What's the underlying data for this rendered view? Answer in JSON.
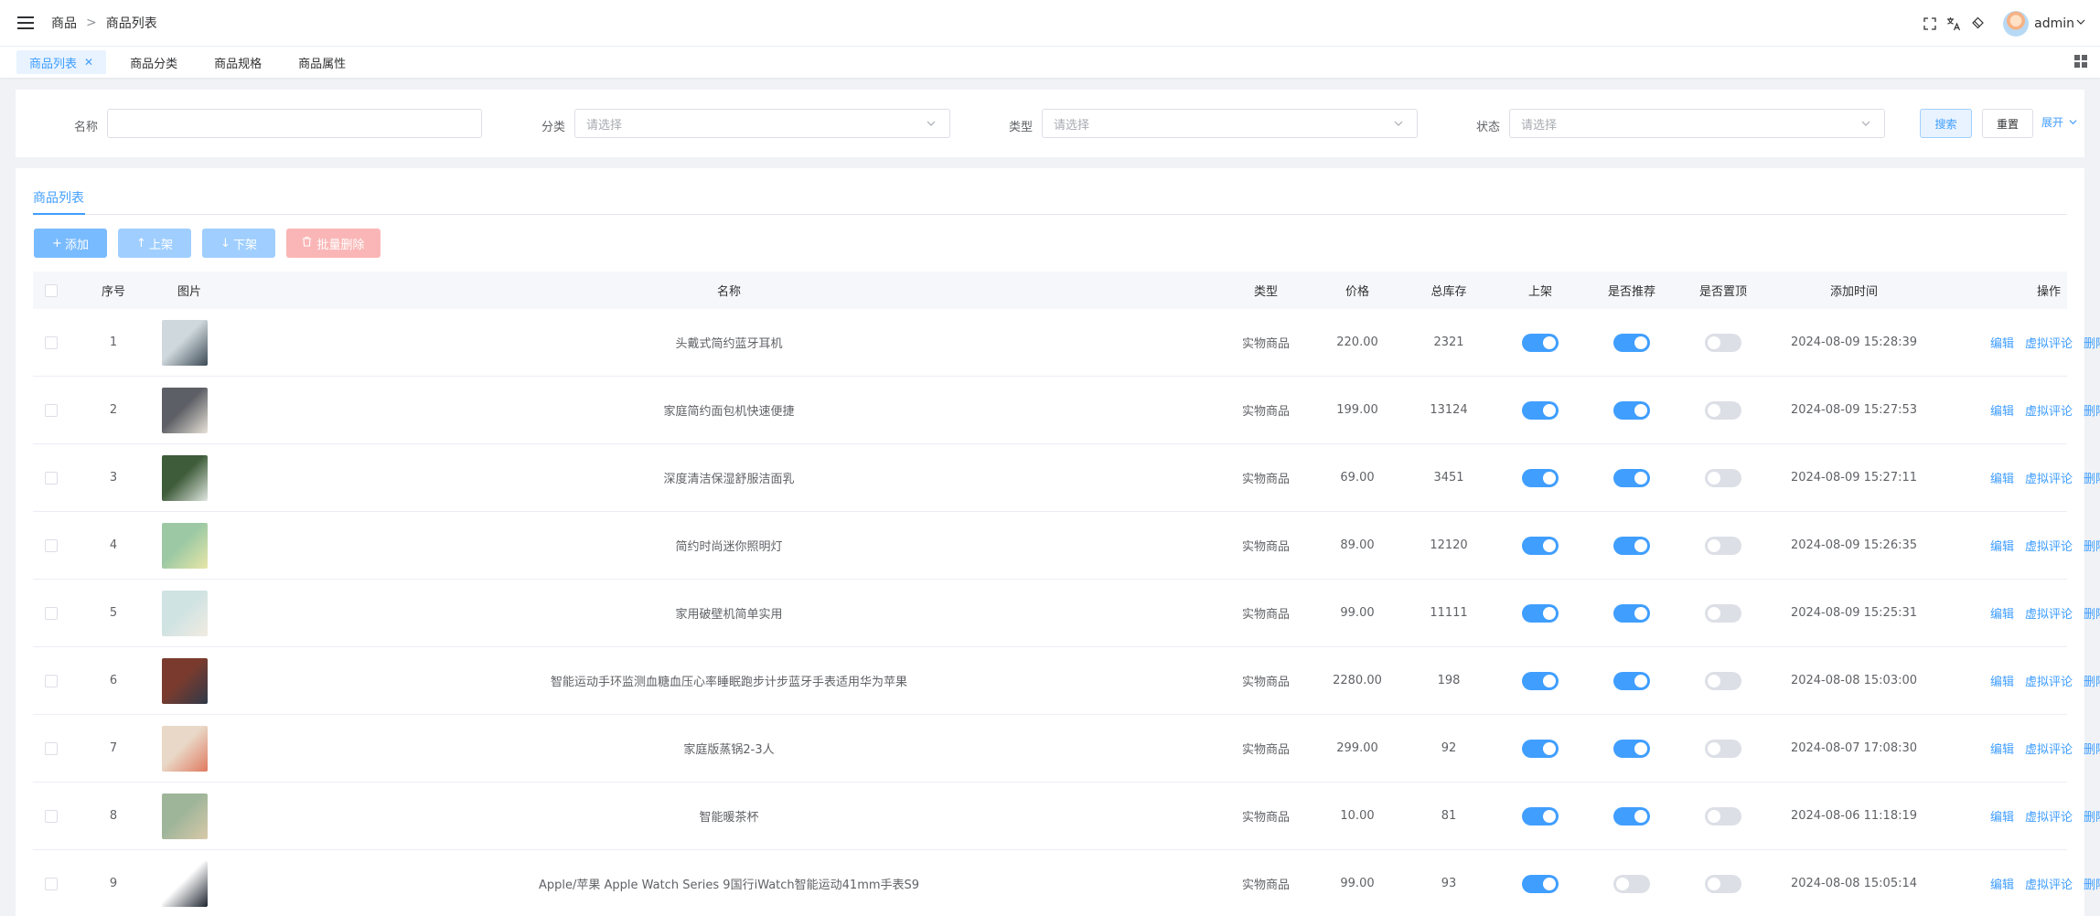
{
  "header": {
    "breadcrumb": [
      "商品",
      "商品列表"
    ],
    "breadcrumb_sep": ">",
    "user": "admin"
  },
  "tabs": [
    {
      "label": "商品列表",
      "active": true
    },
    {
      "label": "商品分类",
      "active": false
    },
    {
      "label": "商品规格",
      "active": false
    },
    {
      "label": "商品属性",
      "active": false
    }
  ],
  "filters": {
    "name_label": "名称",
    "name_value": "",
    "category_label": "分类",
    "category_placeholder": "请选择",
    "type_label": "类型",
    "type_placeholder": "请选择",
    "status_label": "状态",
    "status_placeholder": "请选择",
    "search_button": "搜索",
    "reset_button": "重置",
    "expand_link": "展开"
  },
  "list": {
    "tab_label": "商品列表",
    "add_button": "添加",
    "on_shelf_button": "上架",
    "off_shelf_button": "下架",
    "batch_delete_button": "批量删除",
    "columns": [
      "序号",
      "图片",
      "名称",
      "类型",
      "价格",
      "总库存",
      "上架",
      "是否推荐",
      "是否置顶",
      "添加时间",
      "操作"
    ],
    "op_edit": "编辑",
    "op_review": "虚拟评论",
    "op_delete": "删除",
    "rows": [
      {
        "index": "1",
        "name": "头戴式简约蓝牙耳机",
        "type": "实物商品",
        "price": "220.00",
        "stock": "2321",
        "on_shelf": true,
        "recommended": true,
        "pinned": false,
        "time": "2024-08-09 15:28:39",
        "thumb_colors": [
          "#cfd8dc",
          "#3c4a56"
        ]
      },
      {
        "index": "2",
        "name": "家庭简约面包机快速便捷",
        "type": "实物商品",
        "price": "199.00",
        "stock": "13124",
        "on_shelf": true,
        "recommended": true,
        "pinned": false,
        "time": "2024-08-09 15:27:53",
        "thumb_colors": [
          "#5d5f66",
          "#e8e2d8"
        ]
      },
      {
        "index": "3",
        "name": "深度清洁保湿舒服洁面乳",
        "type": "实物商品",
        "price": "69.00",
        "stock": "3451",
        "on_shelf": true,
        "recommended": true,
        "pinned": false,
        "time": "2024-08-09 15:27:11",
        "thumb_colors": [
          "#3e5b3a",
          "#dfe7df"
        ]
      },
      {
        "index": "4",
        "name": "简约时尚迷你照明灯",
        "type": "实物商品",
        "price": "89.00",
        "stock": "12120",
        "on_shelf": true,
        "recommended": true,
        "pinned": false,
        "time": "2024-08-09 15:26:35",
        "thumb_colors": [
          "#9cc9a4",
          "#e8e6a8"
        ]
      },
      {
        "index": "5",
        "name": "家用破壁机简单实用",
        "type": "实物商品",
        "price": "99.00",
        "stock": "11111",
        "on_shelf": true,
        "recommended": true,
        "pinned": false,
        "time": "2024-08-09 15:25:31",
        "thumb_colors": [
          "#cfe3e2",
          "#f1ebe1"
        ]
      },
      {
        "index": "6",
        "name": "智能运动手环监测血糖血压心率睡眠跑步计步蓝牙手表适用华为苹果",
        "type": "实物商品",
        "price": "2280.00",
        "stock": "198",
        "on_shelf": true,
        "recommended": true,
        "pinned": false,
        "time": "2024-08-08 15:03:00",
        "thumb_colors": [
          "#7a3b2e",
          "#2f3a48"
        ]
      },
      {
        "index": "7",
        "name": "家庭版蒸锅2-3人",
        "type": "实物商品",
        "price": "299.00",
        "stock": "92",
        "on_shelf": true,
        "recommended": true,
        "pinned": false,
        "time": "2024-08-07 17:08:30",
        "thumb_colors": [
          "#e9d8c7",
          "#e07a5f"
        ]
      },
      {
        "index": "8",
        "name": "智能暖茶杯",
        "type": "实物商品",
        "price": "10.00",
        "stock": "81",
        "on_shelf": true,
        "recommended": true,
        "pinned": false,
        "time": "2024-08-06 11:18:19",
        "thumb_colors": [
          "#9fb59a",
          "#d8c9a8"
        ]
      },
      {
        "index": "9",
        "name": "Apple/苹果 Apple Watch Series 9国行iWatch智能运动41mm手表S9",
        "type": "实物商品",
        "price": "99.00",
        "stock": "93",
        "on_shelf": true,
        "recommended": false,
        "pinned": false,
        "time": "2024-08-08 15:05:14",
        "thumb_colors": [
          "#ffffff",
          "#1f2530"
        ]
      }
    ]
  },
  "colors": {
    "primary": "#409eff",
    "primary_light": "#79bbff",
    "danger_light": "#fab6b6",
    "switch_off": "#dcdfe6"
  }
}
